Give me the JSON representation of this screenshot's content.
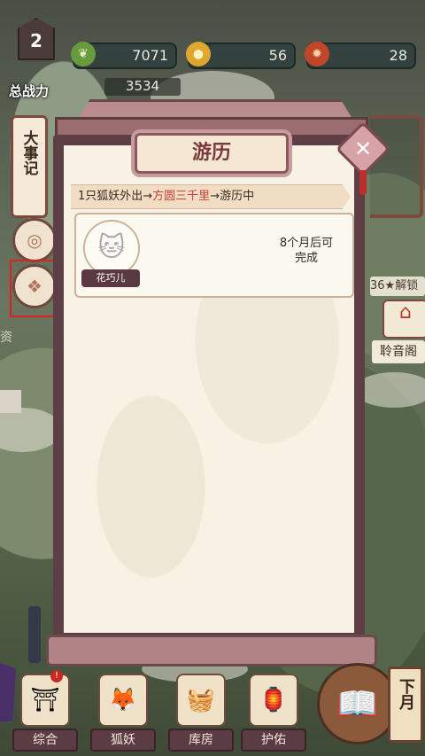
{
  "top": {
    "level": "2",
    "power_label": "总战力",
    "power_value": "3534",
    "resources": [
      {
        "icon": "jade-leaf-icon",
        "value": "7071"
      },
      {
        "icon": "gold-coin-icon",
        "value": "56"
      },
      {
        "icon": "fire-lantern-icon",
        "value": "28"
      }
    ]
  },
  "left": {
    "chronicle": "大事记",
    "side_text": "资"
  },
  "right": {
    "unlock": "36★解锁",
    "pavilion": "聆音阁"
  },
  "modal": {
    "title": "游历",
    "route": {
      "prefix": "1只狐妖外出→",
      "destination": "方圆三千里",
      "suffix": "→游历中"
    },
    "entry": {
      "name": "花巧儿",
      "status_line1": "8个月后可",
      "status_line2": "完成"
    }
  },
  "nav": {
    "items": [
      {
        "label": "综合",
        "icon": "shrine-gate-icon"
      },
      {
        "label": "狐妖",
        "icon": "fox-mask-icon"
      },
      {
        "label": "库房",
        "icon": "storage-basket-icon"
      },
      {
        "label": "护佑",
        "icon": "guardian-lantern-icon"
      }
    ],
    "next_month": "下月"
  }
}
